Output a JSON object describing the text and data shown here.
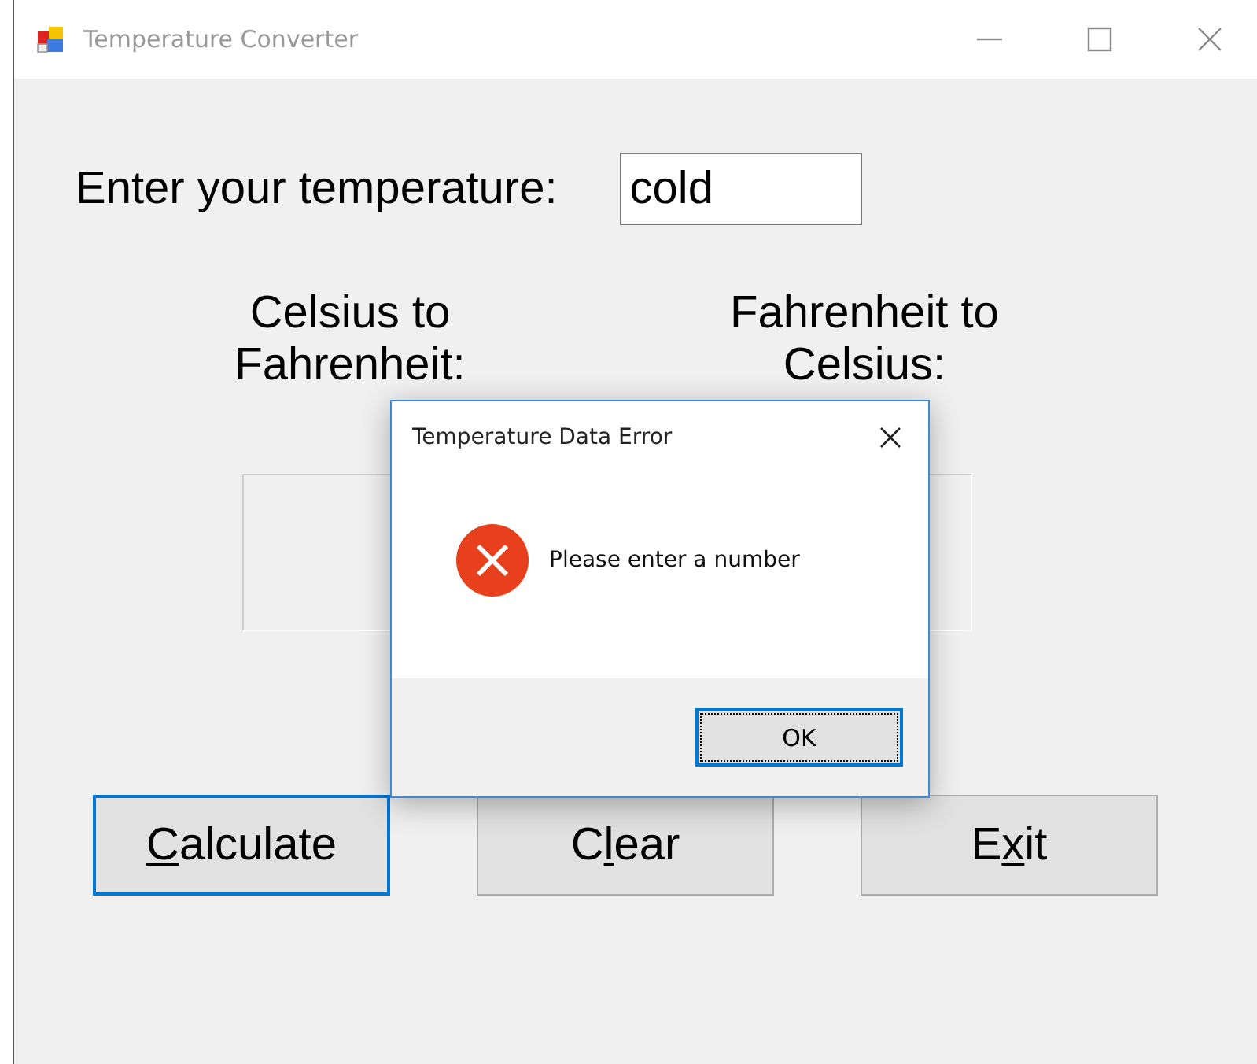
{
  "window": {
    "title": "Temperature Converter"
  },
  "prompt": {
    "label": "Enter your temperature:",
    "value": "cold"
  },
  "conversions": [
    {
      "label": "Celsius to Fahrenheit:"
    },
    {
      "label": "Fahrenheit to Celsius:"
    }
  ],
  "buttons": [
    {
      "key": "C",
      "after": "alculate",
      "focused": true
    },
    {
      "before": "C",
      "key": "l",
      "after": "ear",
      "focused": false
    },
    {
      "before": "E",
      "key": "x",
      "after": "it",
      "focused": false
    }
  ],
  "dialog": {
    "title": "Temperature Data Error",
    "kind": "error",
    "message": "Please enter a number",
    "button": {
      "label": "OK",
      "focused": true
    }
  }
}
